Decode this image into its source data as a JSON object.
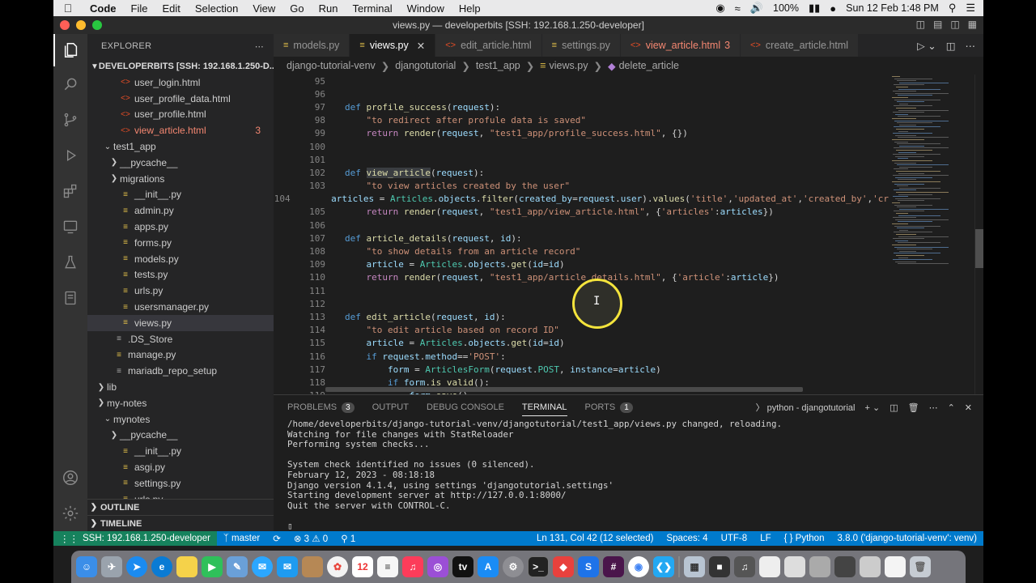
{
  "menubar": {
    "app": "Code",
    "items": [
      "File",
      "Edit",
      "Selection",
      "View",
      "Go",
      "Run",
      "Terminal",
      "Window",
      "Help"
    ],
    "battery": "100%",
    "datetime": "Sun 12 Feb  1:48 PM"
  },
  "window": {
    "title": "views.py — developerbits [SSH: 192.168.1.250-developer]"
  },
  "sidebar": {
    "title": "EXPLORER",
    "root": "DEVELOPERBITS [SSH: 192.168.1.250-D...",
    "tree": [
      {
        "name": "user_login.html",
        "indent": 2,
        "type": "html"
      },
      {
        "name": "user_profile_data.html",
        "indent": 2,
        "type": "html"
      },
      {
        "name": "user_profile.html",
        "indent": 2,
        "type": "html"
      },
      {
        "name": "view_article.html",
        "indent": 2,
        "type": "html",
        "error": true,
        "badge": "3"
      },
      {
        "name": "test1_app",
        "indent": 1,
        "type": "folder-open"
      },
      {
        "name": "__pycache__",
        "indent": 2,
        "type": "folder"
      },
      {
        "name": "migrations",
        "indent": 2,
        "type": "folder"
      },
      {
        "name": "__init__.py",
        "indent": 2,
        "type": "py"
      },
      {
        "name": "admin.py",
        "indent": 2,
        "type": "py"
      },
      {
        "name": "apps.py",
        "indent": 2,
        "type": "py"
      },
      {
        "name": "forms.py",
        "indent": 2,
        "type": "py"
      },
      {
        "name": "models.py",
        "indent": 2,
        "type": "py"
      },
      {
        "name": "tests.py",
        "indent": 2,
        "type": "py"
      },
      {
        "name": "urls.py",
        "indent": 2,
        "type": "py"
      },
      {
        "name": "usersmanager.py",
        "indent": 2,
        "type": "py"
      },
      {
        "name": "views.py",
        "indent": 2,
        "type": "py",
        "selected": true
      },
      {
        "name": ".DS_Store",
        "indent": 1,
        "type": "file"
      },
      {
        "name": "manage.py",
        "indent": 1,
        "type": "py"
      },
      {
        "name": "mariadb_repo_setup",
        "indent": 1,
        "type": "file"
      },
      {
        "name": "lib",
        "indent": 0,
        "type": "folder"
      },
      {
        "name": "my-notes",
        "indent": 0,
        "type": "folder"
      },
      {
        "name": "mynotes",
        "indent": 1,
        "type": "folder-open"
      },
      {
        "name": "__pycache__",
        "indent": 2,
        "type": "folder"
      },
      {
        "name": "__init__.py",
        "indent": 2,
        "type": "py"
      },
      {
        "name": "asgi.py",
        "indent": 2,
        "type": "py"
      },
      {
        "name": "settings.py",
        "indent": 2,
        "type": "py"
      },
      {
        "name": "urls.py",
        "indent": 2,
        "type": "py"
      }
    ],
    "outline": "OUTLINE",
    "timeline": "TIMELINE"
  },
  "tabs": [
    {
      "label": "models.py",
      "type": "py"
    },
    {
      "label": "views.py",
      "type": "py",
      "active": true
    },
    {
      "label": "edit_article.html",
      "type": "html"
    },
    {
      "label": "settings.py",
      "type": "py"
    },
    {
      "label": "view_article.html",
      "type": "html",
      "error": true,
      "badge": "3"
    },
    {
      "label": "create_article.html",
      "type": "html"
    }
  ],
  "breadcrumb": [
    "django-tutorial-venv",
    "djangotutorial",
    "test1_app",
    "views.py",
    "delete_article"
  ],
  "code": [
    {
      "n": "95",
      "t": ""
    },
    {
      "n": "96",
      "t": ""
    },
    {
      "n": "97",
      "t": "def profile_success(request):"
    },
    {
      "n": "98",
      "t": "    \"to redirect after profule data is saved\""
    },
    {
      "n": "99",
      "t": "    return render(request, \"test1_app/profile_success.html\", {})"
    },
    {
      "n": "100",
      "t": ""
    },
    {
      "n": "101",
      "t": ""
    },
    {
      "n": "102",
      "t": "def view_article(request):"
    },
    {
      "n": "103",
      "t": "    \"to view articles created by the user\""
    },
    {
      "n": "104",
      "t": "    articles = Articles.objects.filter(created_by=request.user).values('title','updated_at','created_by','cr"
    },
    {
      "n": "105",
      "t": "    return render(request, \"test1_app/view_article.html\", {'articles':articles})"
    },
    {
      "n": "106",
      "t": ""
    },
    {
      "n": "107",
      "t": "def article_details(request, id):"
    },
    {
      "n": "108",
      "t": "    \"to show details from an article record\""
    },
    {
      "n": "109",
      "t": "    article = Articles.objects.get(id=id)"
    },
    {
      "n": "110",
      "t": "    return render(request, \"test1_app/article_details.html\", {'article':article})"
    },
    {
      "n": "111",
      "t": ""
    },
    {
      "n": "112",
      "t": ""
    },
    {
      "n": "113",
      "t": "def edit_article(request, id):"
    },
    {
      "n": "114",
      "t": "    \"to edit article based on record ID\""
    },
    {
      "n": "115",
      "t": "    article = Articles.objects.get(id=id)"
    },
    {
      "n": "116",
      "t": "    if request.method=='POST':"
    },
    {
      "n": "117",
      "t": "        form = ArticlesForm(request.POST, instance=article)"
    },
    {
      "n": "118",
      "t": "        if form.is_valid():"
    },
    {
      "n": "119",
      "t": "            form.save()"
    }
  ],
  "panel": {
    "tabs": [
      {
        "label": "PROBLEMS",
        "badge": "3"
      },
      {
        "label": "OUTPUT"
      },
      {
        "label": "DEBUG CONSOLE"
      },
      {
        "label": "TERMINAL",
        "active": true
      },
      {
        "label": "PORTS",
        "badge": "1"
      }
    ],
    "terminal_name": "python - djangotutorial",
    "terminal_lines": [
      "/home/developerbits/django-tutorial-venv/djangotutorial/test1_app/views.py changed, reloading.",
      "Watching for file changes with StatReloader",
      "Performing system checks...",
      "",
      "System check identified no issues (0 silenced).",
      "February 12, 2023 - 08:18:18",
      "Django version 4.1.4, using settings 'djangotutorial.settings'",
      "Starting development server at http://127.0.0.1:8000/",
      "Quit the server with CONTROL-C.",
      ""
    ]
  },
  "status": {
    "remote": "SSH: 192.168.1.250-developer",
    "branch": "master",
    "errors": "3",
    "warnings": "0",
    "ports": "1",
    "position": "Ln 131, Col 42 (12 selected)",
    "spaces": "Spaces: 4",
    "encoding": "UTF-8",
    "eol": "LF",
    "language": "Python",
    "interpreter": "3.8.0 ('django-tutorial-venv': venv)"
  },
  "colors": {
    "accent": "#007acc",
    "remote": "#16825d",
    "error": "#f48771"
  }
}
